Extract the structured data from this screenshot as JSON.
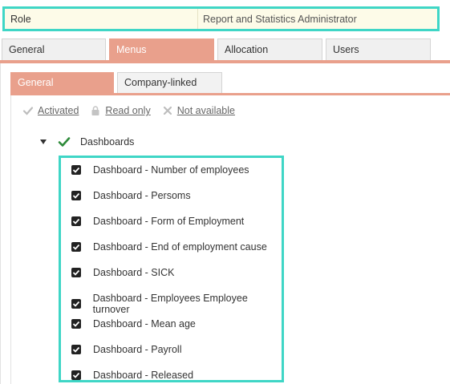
{
  "role": {
    "label": "Role",
    "value": "Report and Statistics Administrator"
  },
  "main_tabs": [
    {
      "label": "General"
    },
    {
      "label": "Menus"
    },
    {
      "label": "Allocation"
    },
    {
      "label": "Users"
    }
  ],
  "sub_tabs": [
    {
      "label": "General"
    },
    {
      "label": "Company-linked"
    }
  ],
  "legend": {
    "activated": "Activated",
    "read_only": "Read only",
    "not_available": "Not available"
  },
  "tree": {
    "root_label": "Dashboards",
    "items": [
      {
        "label": "Dashboard - Number of employees",
        "checked": true
      },
      {
        "label": "Dashboard - Persoms",
        "checked": true
      },
      {
        "label": "Dashboard - Form of Employment",
        "checked": true
      },
      {
        "label": "Dashboard - End of employment cause",
        "checked": true
      },
      {
        "label": "Dashboard - SICK",
        "checked": true
      },
      {
        "label": "Dashboard - Employees Employee turnover",
        "checked": true
      },
      {
        "label": "Dashboard - Mean age",
        "checked": true
      },
      {
        "label": "Dashboard - Payroll",
        "checked": true
      },
      {
        "label": "Dashboard - Released",
        "checked": true
      }
    ]
  },
  "colors": {
    "accent": "#e9a08c",
    "highlight_border": "#3fd6c6",
    "check_green": "#2e8b3a"
  }
}
